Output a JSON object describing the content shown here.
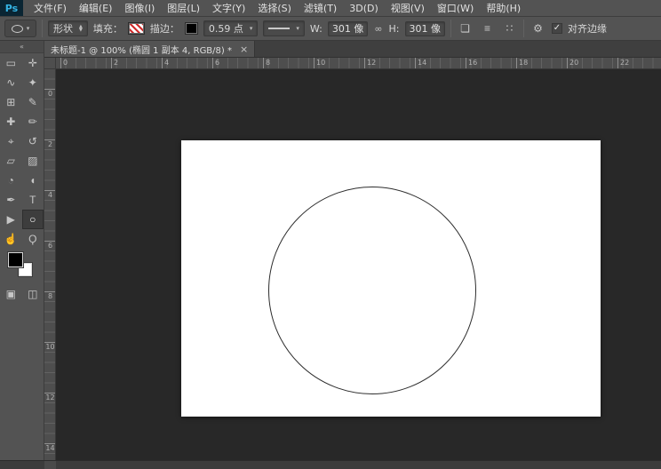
{
  "app": {
    "logo_text": "Ps"
  },
  "menubar": {
    "items": [
      "文件(F)",
      "编辑(E)",
      "图像(I)",
      "图层(L)",
      "文字(Y)",
      "选择(S)",
      "滤镜(T)",
      "3D(D)",
      "视图(V)",
      "窗口(W)",
      "帮助(H)"
    ]
  },
  "options_bar": {
    "tool_mode_value": "形状",
    "fill_label": "填充：",
    "stroke_label": "描边：",
    "stroke_width_value": "0.59 点",
    "w_label": "W:",
    "w_value": "301 像",
    "link_icon": "∞",
    "h_label": "H:",
    "h_value": "301 像",
    "path_ops_icon": "❏",
    "align_icon": "≡",
    "arrange_icon": "∷",
    "gear_icon": "⚙",
    "align_edges_check": "✓",
    "align_edges_label": "对齐边缘"
  },
  "document": {
    "tab_title": "未标题-1 @ 100% (椭圆 1 副本 4, RGB/8) *",
    "close_label": "×"
  },
  "rulers": {
    "horizontal_labels": [
      "0",
      "2",
      "4",
      "6",
      "8",
      "10",
      "12",
      "14",
      "16",
      "18",
      "20",
      "22"
    ],
    "vertical_labels": [
      "0",
      "2",
      "4",
      "6",
      "8",
      "10",
      "12",
      "14"
    ]
  },
  "toolbar": {
    "collapse_glyph": "«",
    "tools": [
      {
        "name": "rectangular-marquee-tool",
        "glyph": "▭"
      },
      {
        "name": "move-tool",
        "glyph": "✛"
      },
      {
        "name": "lasso-tool",
        "glyph": "∿"
      },
      {
        "name": "quick-selection-tool",
        "glyph": "✦"
      },
      {
        "name": "crop-tool",
        "glyph": "⊞"
      },
      {
        "name": "eyedropper-tool",
        "glyph": "✎"
      },
      {
        "name": "healing-brush-tool",
        "glyph": "✚"
      },
      {
        "name": "brush-tool",
        "glyph": "✏"
      },
      {
        "name": "clone-stamp-tool",
        "glyph": "⌖"
      },
      {
        "name": "history-brush-tool",
        "glyph": "↺"
      },
      {
        "name": "eraser-tool",
        "glyph": "▱"
      },
      {
        "name": "gradient-tool",
        "glyph": "▨"
      },
      {
        "name": "blur-tool",
        "glyph": "◔"
      },
      {
        "name": "dodge-tool",
        "glyph": "◖"
      },
      {
        "name": "pen-tool",
        "glyph": "✒"
      },
      {
        "name": "type-tool",
        "glyph": "T"
      },
      {
        "name": "path-selection-tool",
        "glyph": "▶"
      },
      {
        "name": "ellipse-shape-tool",
        "glyph": "○",
        "selected": true
      },
      {
        "name": "hand-tool",
        "glyph": "☝"
      },
      {
        "name": "zoom-tool",
        "glyph": "Ϙ"
      }
    ],
    "extras": [
      {
        "name": "quick-mask-mode-button",
        "glyph": "▣"
      },
      {
        "name": "screen-mode-button",
        "glyph": "◫"
      }
    ]
  },
  "colors": {
    "chrome": "#535353",
    "canvas_background": "#282828",
    "fill_stripe_red": "#cf2b2b",
    "foreground_swatch": "#000000",
    "background_swatch": "#ffffff",
    "shape_stroke": "#2d2d2d"
  }
}
